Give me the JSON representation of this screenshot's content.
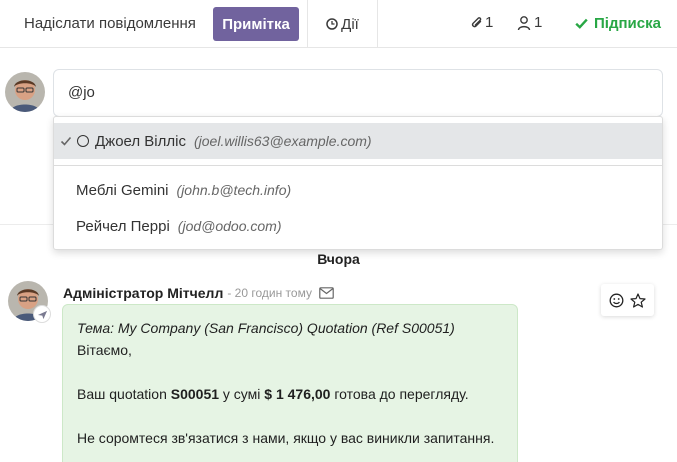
{
  "toolbar": {
    "send_label": "Надіслати повідомлення",
    "note_label": "Примітка",
    "actions_label": "Дії",
    "attachments_count": "1",
    "followers_count": "1",
    "subscribe_label": "Підписка"
  },
  "composer": {
    "value": "@jo"
  },
  "mention_dropdown": {
    "items": [
      {
        "name": "Джоел Вілліс",
        "email": "(joel.willis63@example.com)",
        "active": true
      },
      {
        "name": "Меблі Gemini",
        "email": "(john.b@tech.info)",
        "active": false
      },
      {
        "name": "Рейчел Перрі",
        "email": "(jod@odoo.com)",
        "active": false
      }
    ]
  },
  "thread": {
    "date_separator": "Вчора",
    "message": {
      "author": "Адміністратор Мітчелл",
      "date": "- 20 годин тому",
      "subject": "Тема: My Company (San Francisco) Quotation (Ref S00051)",
      "greeting": "Вітаємо,",
      "body_pre": "Ваш quotation ",
      "body_ref": "S00051",
      "body_mid": " у сумі ",
      "body_amount": "$ 1 476,00",
      "body_post": " готова до перегляду.",
      "closing": "Не соромтеся зв'язатися з нами, якщо у вас виникли запитання."
    }
  },
  "icons": {
    "actions": "clock-icon",
    "attachments": "paperclip-icon",
    "followers": "user-icon",
    "subscribe": "check-icon",
    "message_type": "envelope-icon",
    "reaction": "smile-icon",
    "star": "star-icon",
    "avatar_badge": "plane-icon"
  },
  "colors": {
    "accent": "#71639e",
    "success": "#28a745",
    "bubble": "#e6f4e4"
  }
}
